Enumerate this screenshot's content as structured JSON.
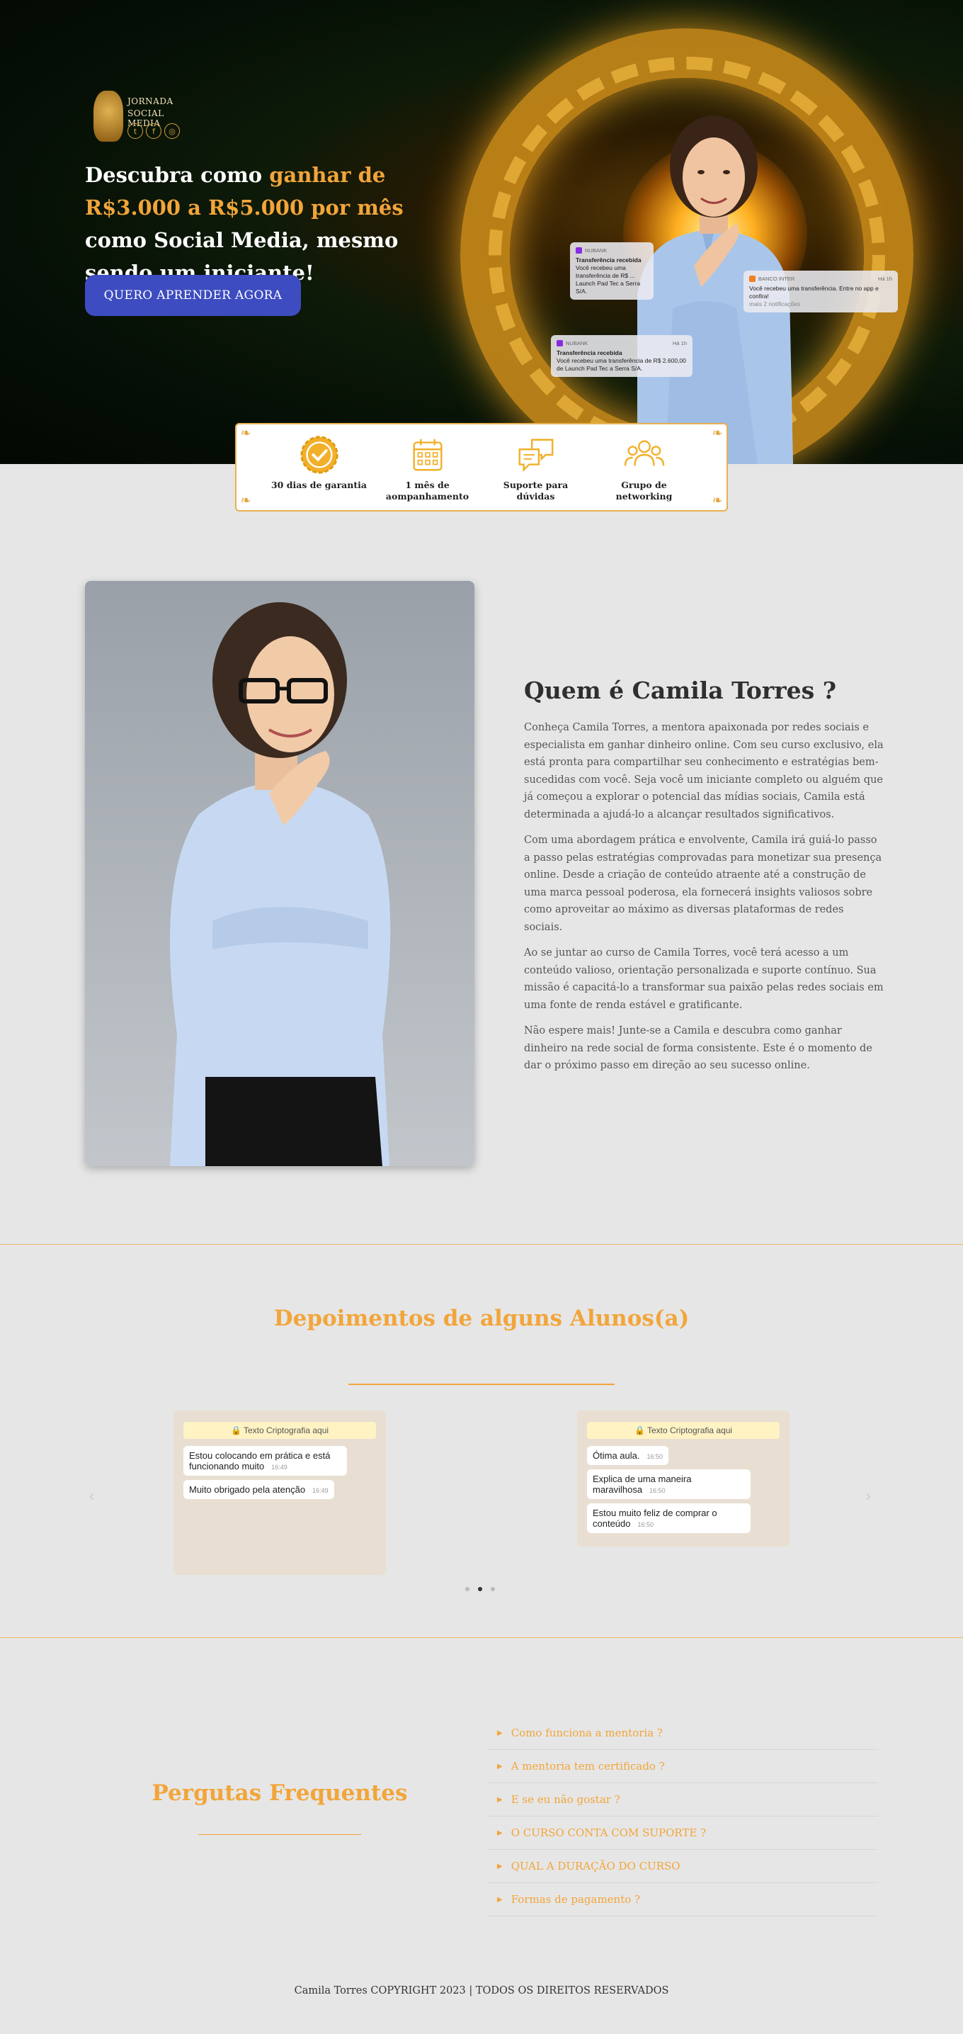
{
  "hero": {
    "logo_line1": "JORNADA",
    "logo_line2": "SOCIAL MEDIA",
    "social_icons": [
      "twitter-icon",
      "facebook-icon",
      "instagram-icon"
    ],
    "headline_part1": "Descubra como ",
    "headline_highlight": "ganhar de R$3.000 a R$5.000 por mês",
    "headline_part2": " como Social Media, mesmo sendo um iniciante!",
    "cta_label": "QUERO APRENDER AGORA",
    "notifications": [
      {
        "app": "NUBANK",
        "title": "Transferência recebida",
        "body": "Você recebeu uma transferência de R$ ... Launch Pad Tec a Serra S/A."
      },
      {
        "app": "BANCO INTER",
        "time": "Há 1h",
        "title": "",
        "body": "Você recebeu uma transferência. Entre no app e confira!",
        "extra": "mais 2 notificações"
      },
      {
        "app": "NUBANK",
        "time": "Há 1h",
        "title": "Transferência recebida",
        "body": "Você recebeu uma transferência de R$ 2.600,00 de Launch Pad Tec a Serra S/A."
      }
    ]
  },
  "features": [
    {
      "icon": "badge-check-icon",
      "label": "30 dias de garantia"
    },
    {
      "icon": "calendar-icon",
      "label": "1 mês de aompanhamento"
    },
    {
      "icon": "chat-bubbles-icon",
      "label": "Suporte para dúvidas"
    },
    {
      "icon": "group-icon",
      "label": "Grupo de networking"
    }
  ],
  "about": {
    "title": "Quem é Camila Torres ?",
    "paragraphs": [
      "Conheça Camila Torres, a mentora apaixonada por redes sociais e especialista em ganhar dinheiro online. Com seu curso exclusivo, ela está pronta para compartilhar seu conhecimento e estratégias bem-sucedidas com você. Seja você um iniciante completo ou alguém que já começou a explorar o potencial das mídias sociais, Camila está determinada a ajudá-lo a alcançar resultados significativos.",
      "Com uma abordagem prática e envolvente, Camila irá guiá-lo passo a passo pelas estratégias comprovadas para monetizar sua presença online. Desde a criação de conteúdo atraente até a construção de uma marca pessoal poderosa, ela fornecerá insights valiosos sobre como aproveitar ao máximo as diversas plataformas de redes sociais.",
      "Ao se juntar ao curso de Camila Torres, você terá acesso a um conteúdo valioso, orientação personalizada e suporte contínuo. Sua missão é capacitá-lo a transformar sua paixão pelas redes sociais em uma fonte de renda estável e gratificante.",
      "Não espere mais! Junte-se a Camila e descubra como ganhar dinheiro na rede social de forma consistente. Este é o momento de dar o próximo passo em direção ao seu sucesso online."
    ]
  },
  "testimonials": {
    "title": "Depoimentos de alguns Alunos(a)",
    "chats": [
      {
        "encryption": "🔒 Texto Criptografia aqui",
        "messages": [
          {
            "text": "Estou colocando em prática e está funcionando muito",
            "time": "16:49"
          },
          {
            "text": "Muito obrigado pela atenção",
            "time": "16:49"
          }
        ]
      },
      {
        "encryption": "🔒 Texto Criptografia aqui",
        "messages": [
          {
            "text": "Ótima aula.",
            "time": "16:50"
          },
          {
            "text": "Explica de uma maneira maravilhosa",
            "time": "16:50"
          },
          {
            "text": "Estou muito feliz de comprar o conteúdo",
            "time": "16:50"
          }
        ]
      }
    ],
    "prev_arrow": "‹",
    "next_arrow": "›"
  },
  "faq": {
    "title": "Pergutas Frequentes",
    "items": [
      "Como funciona a mentoria ?",
      "A mentoria tem certificado ?",
      "E se eu não gostar ?",
      "O CURSO CONTA COM SUPORTE ?",
      "QUAL A DURAÇÃO DO CURSO",
      "Formas de pagamento ?"
    ]
  },
  "footer": {
    "text": "Camila Torres COPYRIGHT 2023 | TODOS OS DIREITOS RESERVADOS"
  },
  "colors": {
    "accent": "#f2a53a",
    "cta": "#3d4cc0",
    "background": "#e6e6e6"
  }
}
